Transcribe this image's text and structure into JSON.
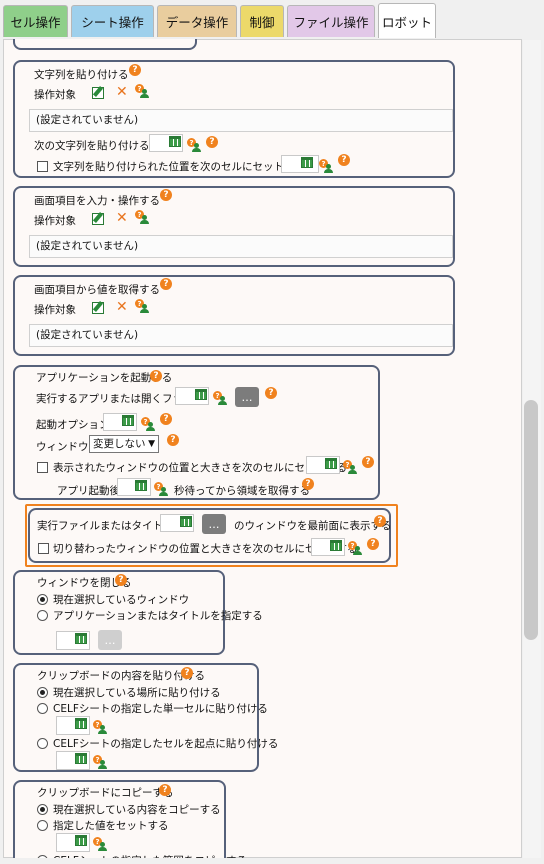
{
  "tabs": [
    {
      "label": "セル操作",
      "color": "#8fcf8a"
    },
    {
      "label": "シート操作",
      "color": "#9ed0ec"
    },
    {
      "label": "データ操作",
      "color": "#e9cd9e"
    },
    {
      "label": "制御",
      "color": "#ecd96a"
    },
    {
      "label": "ファイル操作",
      "color": "#e2c8e8"
    },
    {
      "label": "ロボット",
      "color": "#ffffff"
    }
  ],
  "common": {
    "target_label": "操作対象",
    "not_set": "(設定されていません)",
    "dots": "…",
    "help": "?"
  },
  "paste_string": {
    "title": "文字列を貼り付ける",
    "next_label": "次の文字列を貼り付ける",
    "checkbox_label": "文字列を貼り付けられた位置を次のセルにセットする"
  },
  "input_screen": {
    "title": "画面項目を入力・操作する"
  },
  "get_screen": {
    "title": "画面項目から値を取得する"
  },
  "launch_app": {
    "title": "アプリケーションを起動する",
    "exec_label": "実行するアプリまたは開くファイル",
    "option_label": "起動オプション",
    "window_label": "ウィンドウを",
    "window_select": "変更しない",
    "checkbox_label": "表示されたウィンドウの位置と大きさを次のセルにセットする",
    "after_label": "アプリ起動後",
    "wait_label": "秒待ってから領域を取得する"
  },
  "foreground": {
    "title_prefix": "実行ファイルまたはタイトルが",
    "title_suffix": "のウィンドウを最前面に表示する",
    "checkbox_label": "切り替わったウィンドウの位置と大きさを次のセルにセットする"
  },
  "close_window": {
    "title": "ウィンドウを閉じる",
    "opt1": "現在選択しているウィンドウ",
    "opt2": "アプリケーションまたはタイトルを指定する"
  },
  "paste_clipboard": {
    "title": "クリップボードの内容を貼り付ける",
    "opt1": "現在選択している場所に貼り付ける",
    "opt2": "CELFシートの指定した単一セルに貼り付ける",
    "opt3": "CELFシートの指定したセルを起点に貼り付ける"
  },
  "copy_clipboard": {
    "title": "クリップボードにコピーする",
    "opt1": "現在選択している内容をコピーする",
    "opt2": "指定した値をセットする",
    "opt3": "CELFシートの指定した範囲をコピーする"
  },
  "colors": {
    "accent": "#f0821e",
    "border": "#56617a",
    "excel_green": "#2a7a35"
  }
}
